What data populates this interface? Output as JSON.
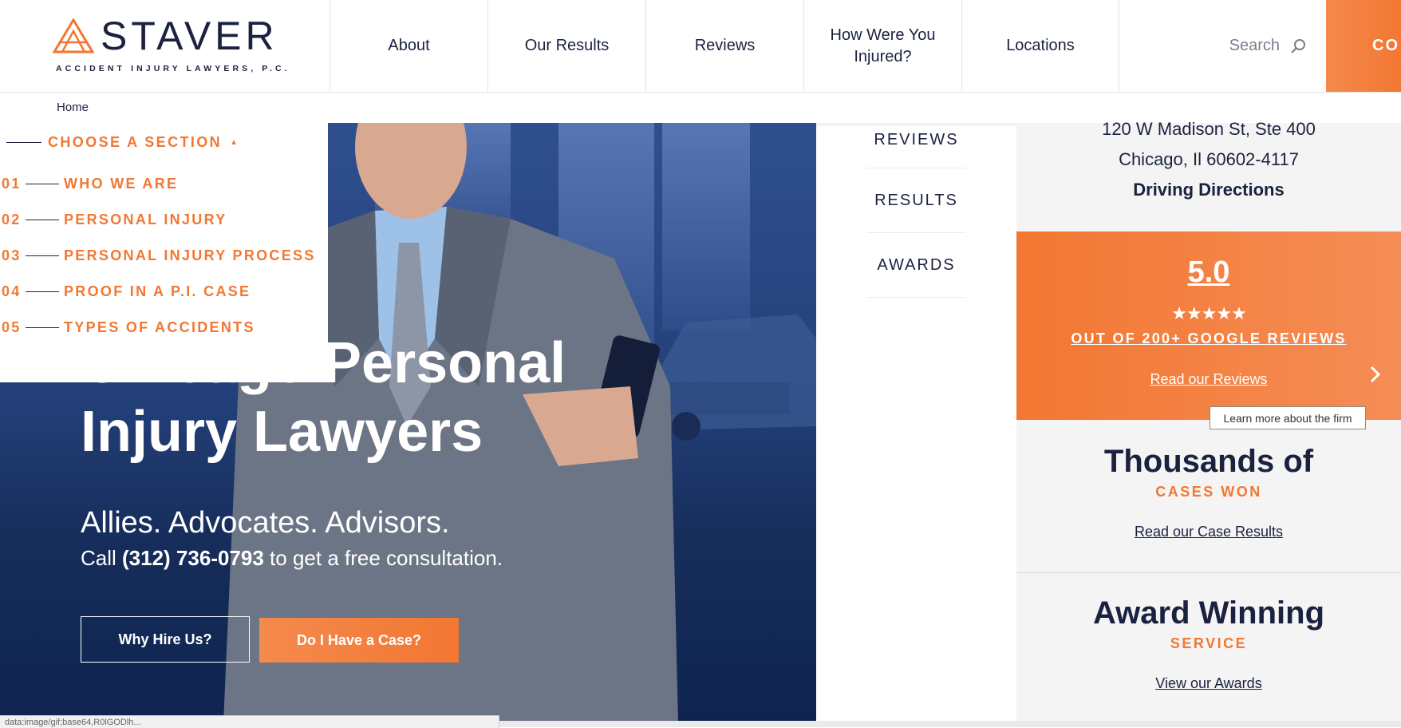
{
  "header": {
    "logo_word": "STAVER",
    "logo_sub": "ACCIDENT INJURY LAWYERS, P.C.",
    "nav": [
      {
        "label": "About"
      },
      {
        "label": "Our Results"
      },
      {
        "label": "Reviews"
      },
      {
        "label": "How Were You Injured?"
      },
      {
        "label": "Locations"
      }
    ],
    "search_label": "Search",
    "cta_label": "CO"
  },
  "breadcrumb": {
    "home": "Home"
  },
  "section_menu": {
    "title": "CHOOSE A SECTION",
    "items": [
      {
        "num": "01",
        "label": "WHO WE ARE"
      },
      {
        "num": "02",
        "label": "PERSONAL INJURY"
      },
      {
        "num": "03",
        "label": "PERSONAL INJURY PROCESS"
      },
      {
        "num": "04",
        "label": "PROOF IN A P.I. CASE"
      },
      {
        "num": "05",
        "label": "TYPES OF ACCIDENTS"
      }
    ]
  },
  "hero": {
    "title_line1": "Chicago Personal",
    "title_line2": "Injury Lawyers",
    "subtitle": "Allies. Advocates. Advisors.",
    "call_prefix": "Call ",
    "phone": "(312) 736-0793",
    "call_suffix": " to get a free consultation.",
    "btn_why": "Why Hire Us?",
    "btn_case": "Do I Have a Case?"
  },
  "side_tabs": [
    {
      "label": "REVIEWS"
    },
    {
      "label": "RESULTS"
    },
    {
      "label": "AWARDS"
    }
  ],
  "right": {
    "address1": "120 W Madison St, Ste 400",
    "address2": "Chicago, Il 60602-4117",
    "directions": "Driving Directions",
    "rating": "5.0",
    "stars": "★★★★★",
    "out_of": "OUT OF 200+ GOOGLE REVIEWS",
    "read_reviews": "Read our Reviews",
    "tooltip": "Learn more about the firm",
    "cases_title": "Thousands of",
    "cases_sub": "CASES WON",
    "cases_link": "Read our Case Results",
    "awards_title": "Award Winning",
    "awards_sub": "SERVICE",
    "awards_link": "View our Awards"
  },
  "statusbar": "data:image/gif;base64,R0lGODlh...",
  "colors": {
    "accent": "#f27732",
    "navy": "#1b2240",
    "hero_blue": "#1b3566"
  },
  "icons": [
    "staver-logo-icon",
    "search-icon",
    "caret-up-icon",
    "chevron-right-icon"
  ]
}
